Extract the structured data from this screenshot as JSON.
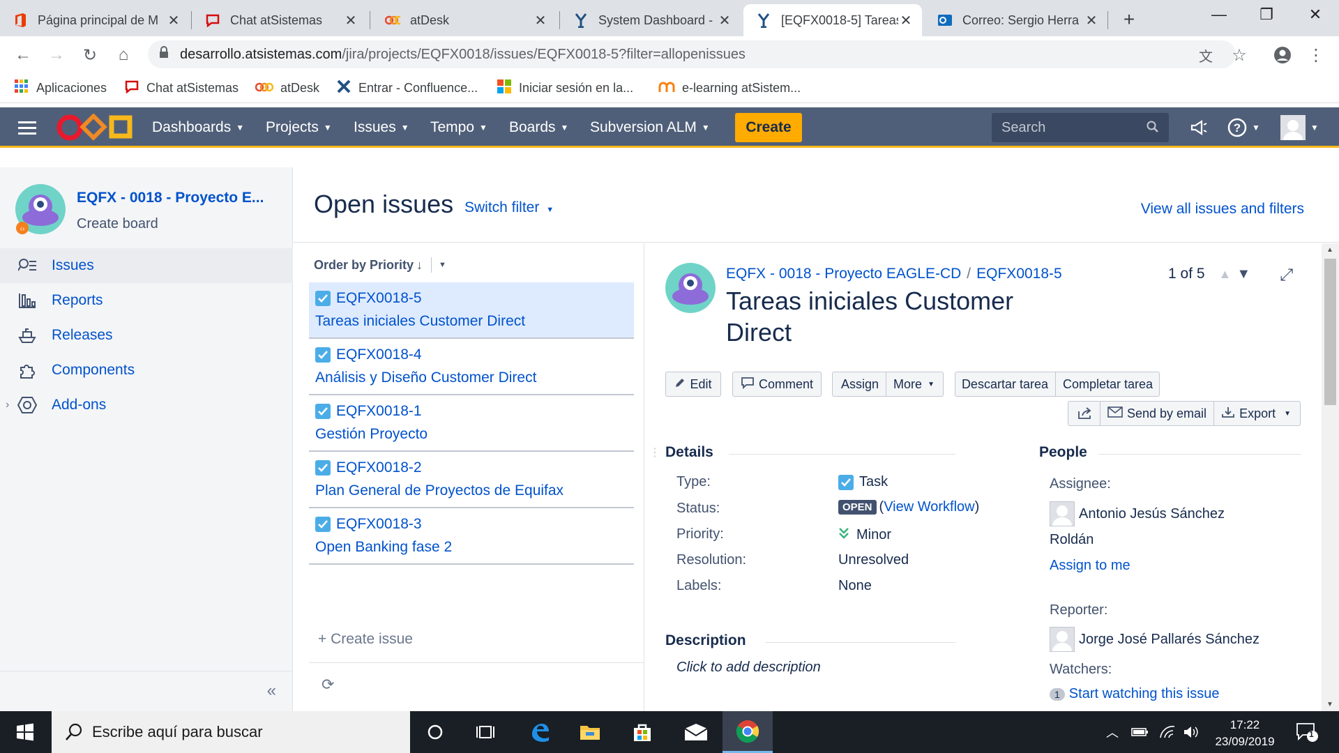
{
  "browser": {
    "tabs": [
      {
        "title": "Página principal de M",
        "icon": "office-icon"
      },
      {
        "title": "Chat atSistemas",
        "icon": "chat-icon"
      },
      {
        "title": "atDesk",
        "icon": "atdesk-icon"
      },
      {
        "title": "System Dashboard -",
        "icon": "jira-icon"
      },
      {
        "title": "[EQFX0018-5] Tareas",
        "icon": "jira-icon"
      },
      {
        "title": "Correo: Sergio Herra",
        "icon": "outlook-icon"
      }
    ],
    "url_host": "desarrollo.atsistemas.com",
    "url_path": "/jira/projects/EQFX0018/issues/EQFX0018-5?filter=allopenissues",
    "bookmarks": [
      {
        "label": "Aplicaciones",
        "icon": "apps-grid-icon"
      },
      {
        "label": "Chat atSistemas",
        "icon": "chat-icon"
      },
      {
        "label": "atDesk",
        "icon": "atdesk-icon"
      },
      {
        "label": "Entrar - Confluence...",
        "icon": "confluence-icon"
      },
      {
        "label": "Iniciar sesión en la...",
        "icon": "microsoft-icon"
      },
      {
        "label": "e-learning atSistem...",
        "icon": "moodle-icon"
      }
    ]
  },
  "jira": {
    "nav": [
      "Dashboards",
      "Projects",
      "Issues",
      "Tempo",
      "Boards",
      "Subversion ALM"
    ],
    "create_label": "Create",
    "search_placeholder": "Search",
    "accent": "#f6b81c",
    "header_bg": "#505f79"
  },
  "sidebar": {
    "project_name": "EQFX - 0018 - Proyecto E...",
    "project_sub": "Create board",
    "items": [
      {
        "label": "Issues",
        "icon": "issues-icon"
      },
      {
        "label": "Reports",
        "icon": "reports-icon"
      },
      {
        "label": "Releases",
        "icon": "releases-icon"
      },
      {
        "label": "Components",
        "icon": "components-icon"
      },
      {
        "label": "Add-ons",
        "icon": "addons-icon"
      }
    ],
    "collapse_label": "«"
  },
  "page": {
    "title": "Open issues",
    "switch_filter": "Switch filter",
    "view_all": "View all issues and filters",
    "order_by": "Order by Priority",
    "create_issue": "+ Create issue"
  },
  "issues": [
    {
      "key": "EQFX0018-5",
      "summary": "Tareas iniciales Customer Direct"
    },
    {
      "key": "EQFX0018-4",
      "summary": "Análisis y Diseño Customer Direct"
    },
    {
      "key": "EQFX0018-1",
      "summary": "Gestión Proyecto"
    },
    {
      "key": "EQFX0018-2",
      "summary": "Plan General de Proyectos de Equifax"
    },
    {
      "key": "EQFX0018-3",
      "summary": "Open Banking fase 2"
    }
  ],
  "detail": {
    "project_crumb": "EQFX - 0018 - Proyecto EAGLE-CD",
    "crumb_sep": "/",
    "issue_crumb": "EQFX0018-5",
    "title": "Tareas iniciales Customer Direct",
    "pager": "1 of 5",
    "buttons": {
      "edit": "Edit",
      "comment": "Comment",
      "assign": "Assign",
      "more": "More",
      "discard": "Descartar tarea",
      "complete": "Completar tarea",
      "send_email": "Send by email",
      "export": "Export"
    },
    "details_heading": "Details",
    "fields": {
      "type_label": "Type:",
      "type_value": "Task",
      "status_label": "Status:",
      "status_value": "OPEN",
      "view_workflow": "View Workflow",
      "priority_label": "Priority:",
      "priority_value": "Minor",
      "resolution_label": "Resolution:",
      "resolution_value": "Unresolved",
      "labels_label": "Labels:",
      "labels_value": "None"
    },
    "description_heading": "Description",
    "description_placeholder": "Click to add description",
    "people_heading": "People",
    "people": {
      "assignee_label": "Assignee:",
      "assignee_name_1": "Antonio Jesús Sánchez",
      "assignee_name_2": "Roldán",
      "assign_to_me": "Assign to me",
      "reporter_label": "Reporter:",
      "reporter_name": "Jorge José Pallarés Sánchez",
      "watchers_label": "Watchers:",
      "watchers_count": "1",
      "start_watching": "Start watching this issue"
    }
  },
  "taskbar": {
    "search_placeholder": "Escribe aquí para buscar",
    "time": "17:22",
    "date": "23/09/2019",
    "notification_count": "1"
  }
}
